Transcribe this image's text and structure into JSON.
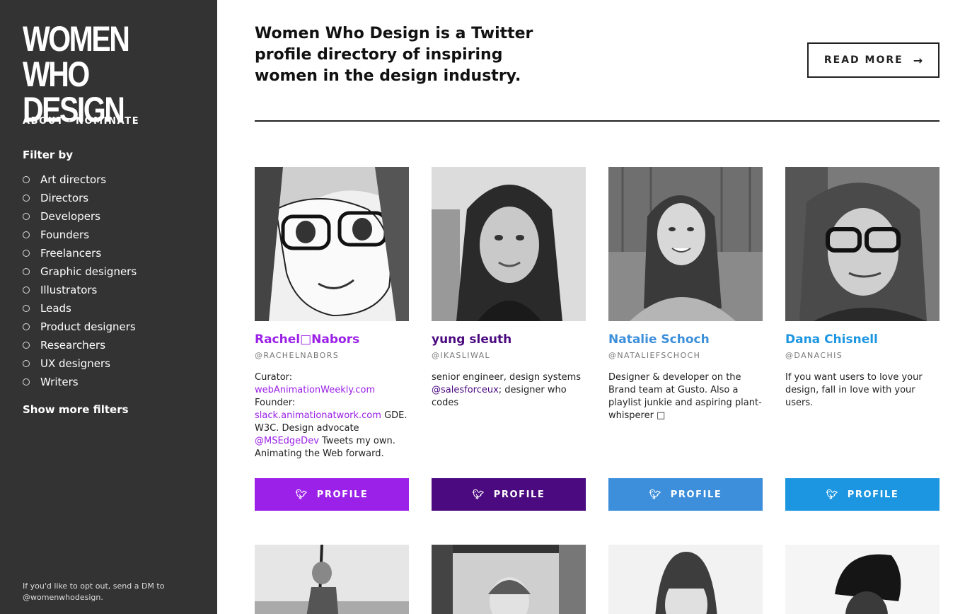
{
  "sidebar": {
    "logo_line1": "WOMEN",
    "logo_line2": "WHO DESIGN",
    "nav_about": "ABOUT",
    "nav_sep": "·",
    "nav_nominate": "NOMINATE",
    "filter_title": "Filter by",
    "filters": [
      "Art directors",
      "Directors",
      "Developers",
      "Founders",
      "Freelancers",
      "Graphic designers",
      "Illustrators",
      "Leads",
      "Product designers",
      "Researchers",
      "UX designers",
      "Writers"
    ],
    "show_more": "Show more filters",
    "optout": "If you'd like to opt out, send a DM to @womenwhodesign."
  },
  "header": {
    "intro": "Women Who Design is a Twitter profile directory of inspiring women in the design industry.",
    "read_more": "READ MORE",
    "read_more_arrow": "→"
  },
  "colors": {
    "sidebar_bg": "#333333",
    "purple": "#9b20e8",
    "dark_purple": "#4b0a80",
    "blue_light": "#3d8fdb",
    "blue": "#1d96e2"
  },
  "cards": [
    {
      "name": "Rachel□Nabors",
      "handle": "@RACHELNABORS",
      "bio": [
        {
          "t": "Curator: "
        },
        {
          "t": "webAnimationWeekly.com",
          "link": true
        },
        {
          "t": " Founder: "
        },
        {
          "t": "slack.animationatwork.com",
          "link": true
        },
        {
          "t": " GDE. W3C. Design advocate "
        },
        {
          "t": "@MSEdgeDev",
          "link": true
        },
        {
          "t": " Tweets my own. Animating the Web forward."
        }
      ],
      "button": "PROFILE",
      "icon": "twitter-icon",
      "color": "#9b20e8"
    },
    {
      "name": "yung sleuth",
      "handle": "@IKASLIWAL",
      "bio": [
        {
          "t": "senior engineer, design systems "
        },
        {
          "t": "@salesforceux",
          "link": true
        },
        {
          "t": "; designer who codes"
        }
      ],
      "button": "PROFILE",
      "icon": "twitter-icon",
      "color": "#4b0a80"
    },
    {
      "name": "Natalie Schoch",
      "handle": "@NATALIEFSCHOCH",
      "bio": [
        {
          "t": "Designer & developer on the Brand team at Gusto. Also a playlist junkie and aspiring plant-whisperer □"
        }
      ],
      "button": "PROFILE",
      "icon": "twitter-icon",
      "color": "#3d8fdb"
    },
    {
      "name": "Dana Chisnell",
      "handle": "@DANACHIS",
      "bio": [
        {
          "t": "If you want users to love your design, fall in love with your users."
        }
      ],
      "button": "PROFILE",
      "icon": "twitter-icon",
      "color": "#1d96e2"
    }
  ]
}
